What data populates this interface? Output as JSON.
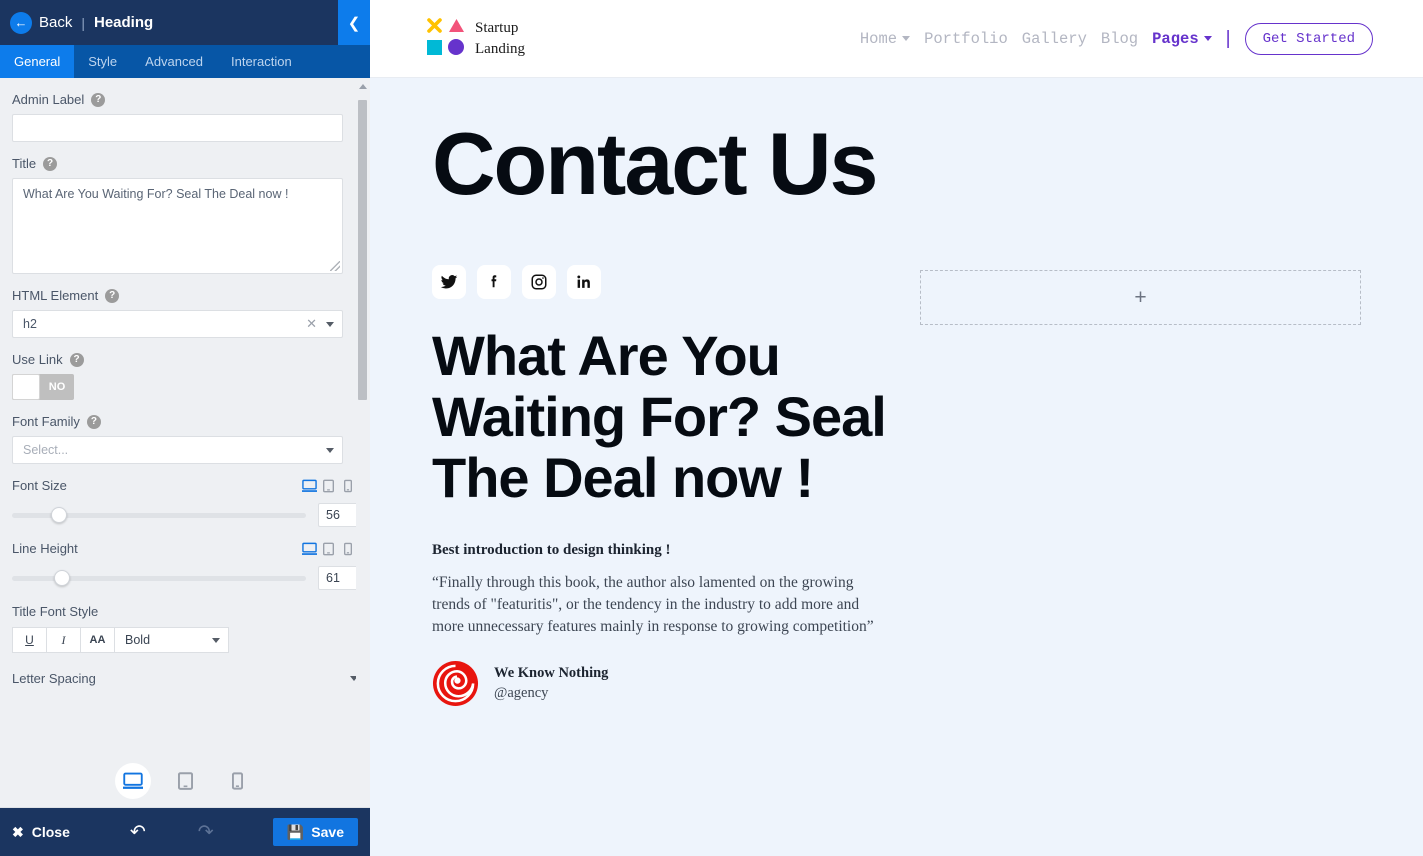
{
  "panel": {
    "header": {
      "back_label": "Back",
      "separator": "|",
      "title": "Heading",
      "collapse_icon": "chevron-left"
    },
    "tabs": [
      {
        "label": "General",
        "active": true
      },
      {
        "label": "Style",
        "active": false
      },
      {
        "label": "Advanced",
        "active": false
      },
      {
        "label": "Interaction",
        "active": false
      }
    ],
    "fields": {
      "admin_label": {
        "label": "Admin Label",
        "value": "",
        "placeholder": ""
      },
      "title": {
        "label": "Title",
        "value": "What Are You Waiting For? Seal The Deal now !"
      },
      "html_element": {
        "label": "HTML Element",
        "value": "h2",
        "clear_icon": "x",
        "caret_icon": "chevron-down"
      },
      "use_link": {
        "label": "Use Link",
        "state": "NO"
      },
      "font_family": {
        "label": "Font Family",
        "value": "",
        "placeholder": "Select..."
      },
      "font_size": {
        "label": "Font Size",
        "value": "56"
      },
      "line_height": {
        "label": "Line Height",
        "value": "61"
      },
      "title_font_style": {
        "label": "Title Font Style",
        "buttons": [
          "U",
          "I",
          "AA"
        ],
        "weight_value": "Bold"
      },
      "letter_spacing": {
        "label": "Letter Spacing"
      }
    },
    "device_toggle": {
      "options": [
        "desktop",
        "tablet",
        "mobile"
      ],
      "selected": "desktop"
    },
    "footer": {
      "close_label": "Close",
      "undo_icon": "undo-arrow",
      "redo_icon": "redo-arrow",
      "save_label": "Save"
    }
  },
  "site": {
    "logo": {
      "line1": "Startup",
      "line2": "Landing",
      "mark_colors": {
        "x": "#ffc200",
        "triangle": "#f2537a",
        "square": "#00b9d6",
        "circle": "#6633cc"
      }
    },
    "nav": [
      {
        "label": "Home",
        "has_caret": true,
        "active": false
      },
      {
        "label": "Portfolio",
        "has_caret": false,
        "active": false
      },
      {
        "label": "Gallery",
        "has_caret": false,
        "active": false
      },
      {
        "label": "Blog",
        "has_caret": false,
        "active": false
      },
      {
        "label": "Pages",
        "has_caret": true,
        "active": true
      }
    ],
    "nav_divider": "|",
    "cta_label": "Get Started",
    "hero_title": "Contact Us",
    "socials": [
      "twitter",
      "facebook",
      "instagram",
      "linkedin"
    ],
    "heading": "What Are You Waiting For? Seal The Deal now !",
    "quote_heading": "Best introduction to design thinking !",
    "quote_body": "“Finally through this book, the author also lamented on the growing trends of \"featuritis\", or the tendency in the industry to add more and more unnecessary features mainly in response to growing competition”",
    "author_name": "We Know Nothing",
    "author_handle": "@agency",
    "dropzone_icon": "+"
  },
  "colors": {
    "panel_header": "#1b3560",
    "tab_bar": "#0756a6",
    "accent_blue": "#0d7ceb",
    "save_blue": "#1275e0",
    "preview_bg": "#eef4fc",
    "brand_purple": "#6633cc"
  }
}
